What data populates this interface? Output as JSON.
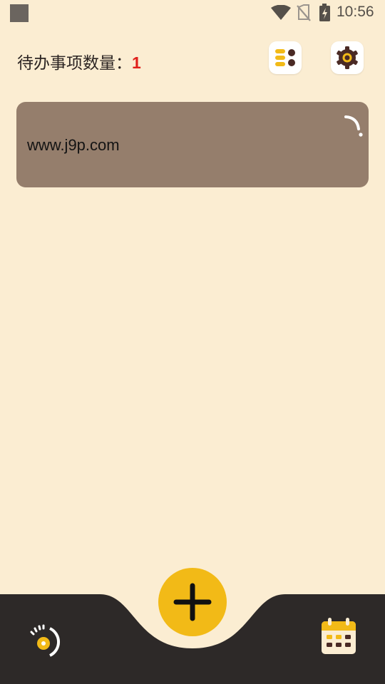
{
  "status_bar": {
    "time": "10:56",
    "icons": [
      "notification-square-icon",
      "wifi-icon",
      "no-sim-icon",
      "battery-charging-icon"
    ]
  },
  "header": {
    "label": "待办事项数量：",
    "count": "1",
    "list_button_icon": "list-icon",
    "settings_button_icon": "gear-icon"
  },
  "todos": [
    {
      "text": "www.j9p.com",
      "status_icon": "loading-icon"
    }
  ],
  "bottom_nav": {
    "left_icon": "dashboard-gauge-icon",
    "add_icon": "plus-icon",
    "right_icon": "calendar-icon"
  },
  "colors": {
    "background": "#FBEDD2",
    "card": "#957E6C",
    "accent": "#F2BA17",
    "nav_bar": "#2D2928",
    "count": "#E0201B",
    "dark": "#4A2A24"
  }
}
